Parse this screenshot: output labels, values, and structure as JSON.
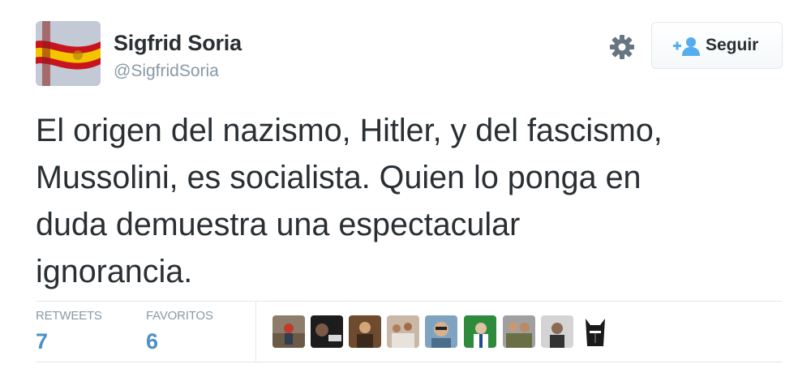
{
  "profile": {
    "name": "Sigfrid Soria",
    "handle": "@SigfridSoria",
    "avatar_icon": "spanish-flag-avatar"
  },
  "actions": {
    "settings_icon": "gear-icon",
    "follow_icon": "follow-user-icon",
    "follow_label": "Seguir"
  },
  "tweet": {
    "lines": [
      "El origen del nazismo, Hitler, y del fascismo,",
      "Mussolini, es socialista. Quien lo ponga en",
      "duda demuestra una espectacular",
      "ignorancia."
    ]
  },
  "stats": {
    "retweets_label": "RETWEETS",
    "retweets_value": "7",
    "favorites_label": "FAVORITOS",
    "favorites_value": "6"
  },
  "favoriters": [
    {
      "icon": "user-avatar"
    },
    {
      "icon": "user-avatar"
    },
    {
      "icon": "user-avatar"
    },
    {
      "icon": "user-avatar"
    },
    {
      "icon": "user-avatar"
    },
    {
      "icon": "user-avatar"
    },
    {
      "icon": "user-avatar"
    },
    {
      "icon": "user-avatar"
    },
    {
      "icon": "helmet-avatar"
    }
  ],
  "colors": {
    "text": "#292f33",
    "muted": "#8899a6",
    "link_blue": "#4a90c8",
    "follow_icon": "#55acee",
    "border": "#e1e8ed"
  }
}
